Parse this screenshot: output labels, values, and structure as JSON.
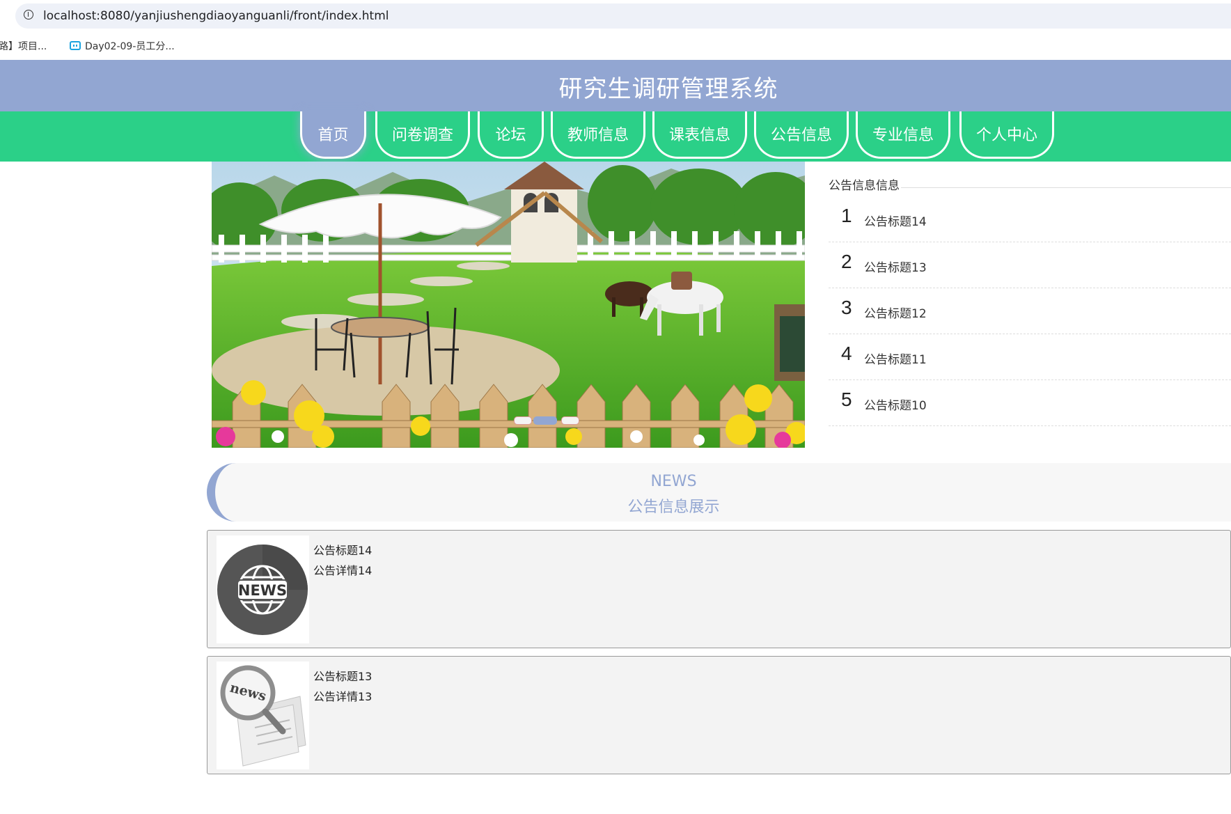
{
  "browser": {
    "url": "localhost:8080/yanjiushengdiaoyanguanli/front/index.html",
    "bookmarks": [
      {
        "label": "路】项目..."
      },
      {
        "label": "Day02-09-员工分..."
      }
    ]
  },
  "header": {
    "title": "研究生调研管理系统"
  },
  "nav": {
    "items": [
      {
        "label": "首页"
      },
      {
        "label": "问卷调查"
      },
      {
        "label": "论坛"
      },
      {
        "label": "教师信息"
      },
      {
        "label": "课表信息"
      },
      {
        "label": "公告信息"
      },
      {
        "label": "专业信息"
      },
      {
        "label": "个人中心"
      }
    ],
    "active_index": 0
  },
  "carousel": {
    "slide_count": 3,
    "active_index": 1
  },
  "notice_panel": {
    "title": "公告信息信息",
    "items": [
      {
        "num": "1",
        "title": "公告标题14"
      },
      {
        "num": "2",
        "title": "公告标题13"
      },
      {
        "num": "3",
        "title": "公告标题12"
      },
      {
        "num": "4",
        "title": "公告标题11"
      },
      {
        "num": "5",
        "title": "公告标题10"
      }
    ]
  },
  "news_section": {
    "en_title": "NEWS",
    "cn_title": "公告信息展示",
    "items": [
      {
        "title": "公告标题14",
        "detail": "公告详情14",
        "thumb_text": "NEWS"
      },
      {
        "title": "公告标题13",
        "detail": "公告详情13",
        "thumb_text": "news"
      }
    ]
  },
  "colors": {
    "header_bg": "#92a6d2",
    "nav_bg": "#2bd088",
    "accent": "#92a6d2"
  }
}
